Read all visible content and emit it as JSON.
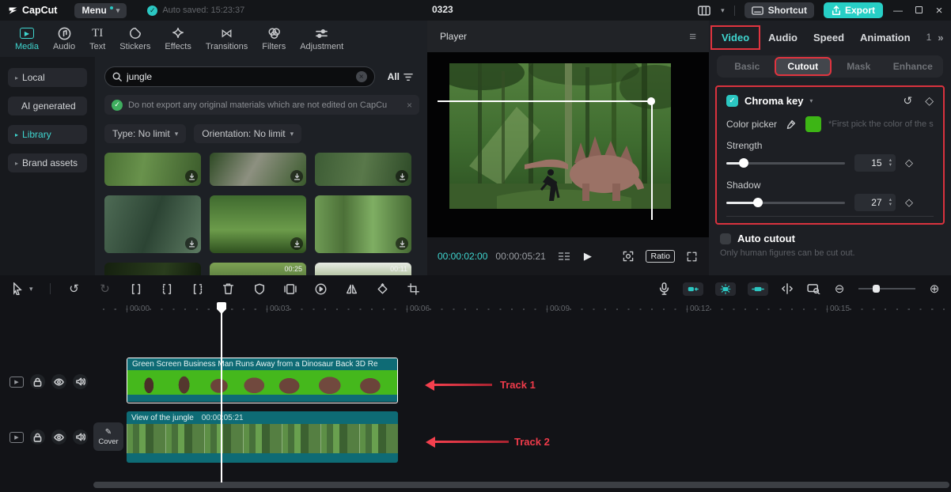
{
  "topbar": {
    "logo": "CapCut",
    "menu_label": "Menu",
    "autosave": "Auto saved: 15:23:37",
    "project_title": "0323",
    "shortcut_label": "Shortcut",
    "export_label": "Export"
  },
  "left_panel": {
    "tabs": [
      "Media",
      "Audio",
      "Text",
      "Stickers",
      "Effects",
      "Transitions",
      "Filters",
      "Adjustment"
    ],
    "sidebar": [
      "Local",
      "AI generated",
      "Library",
      "Brand assets"
    ],
    "search": {
      "value": "jungle",
      "all_label": "All"
    },
    "notice": "Do not export any original materials which are not edited on CapCu",
    "filters": [
      "Type: No limit",
      "Orientation: No limit"
    ],
    "thumb_badges": [
      "00:25",
      "00:11"
    ]
  },
  "player": {
    "title": "Player",
    "current_time": "00:00:02:00",
    "duration": "00:00:05:21",
    "ratio_label": "Ratio"
  },
  "right_panel": {
    "tabs": [
      "Video",
      "Audio",
      "Speed",
      "Animation"
    ],
    "tab_extra": "1",
    "tab_chevrons": "»",
    "subtabs": [
      "Basic",
      "Cutout",
      "Mask",
      "Enhance"
    ],
    "chroma": {
      "title": "Chroma key",
      "color_picker_label": "Color picker",
      "hint": "*First pick the color of the scre...",
      "strength_label": "Strength",
      "strength_value": "15",
      "shadow_label": "Shadow",
      "shadow_value": "27",
      "swatch_color": "#3db515"
    },
    "auto_cutout": {
      "label": "Auto cutout",
      "hint": "Only human figures can be cut out."
    }
  },
  "timeline": {
    "ruler": [
      "00:00",
      "00:03",
      "00:06",
      "00:09",
      "00:12",
      "00:15"
    ],
    "track1": {
      "clip_title": "Green Screen Business Man Runs Away from a Dinosaur Back 3D Re"
    },
    "track2": {
      "clip_title": "View of the jungle",
      "clip_duration": "00:00:05:21",
      "cover_label": "Cover"
    },
    "annotations": [
      "Track 1",
      "Track 2"
    ]
  },
  "colors": {
    "accent_teal": "#3fd5cf",
    "export_teal": "#27cfc6",
    "annotation_red": "#ef3b4a",
    "highlight_red_box": "#e0343f",
    "chroma_swatch": "#3db515",
    "clip_teal": "#0e6b75",
    "green_screen": "#45b81c"
  },
  "glyphs": {
    "caret_down": "▾",
    "arrow_right": "▸",
    "check": "✓",
    "close_x": "×",
    "hamburger": "≡",
    "play": "▶",
    "note": "♪",
    "bowtie": "⋈",
    "reset": "↺",
    "redo": "↻",
    "diamond": "◇",
    "step_up": "▴",
    "step_down": "▾",
    "pencil": "✎",
    "minimize": "—",
    "zoom_out": "⊖",
    "zoom_in": "⊕",
    "text_ti": "TI",
    "search_clear": "×"
  }
}
